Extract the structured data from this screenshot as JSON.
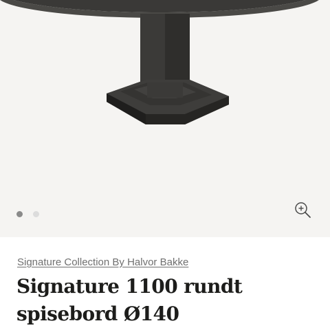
{
  "gallery": {
    "image": "round-dining-table-pedestal",
    "slides_total": 2,
    "active_slide": 1,
    "zoom_icon": "zoom-in-icon",
    "colors": {
      "background": "#f5f4f2",
      "table": "#3b3a38",
      "dot_active": "#8a8a8a",
      "dot_inactive": "#dcdcdc"
    }
  },
  "product": {
    "collection": "Signature Collection By Halvor Bakke",
    "title": "Signature 1100 rundt spisebord Ø140"
  }
}
